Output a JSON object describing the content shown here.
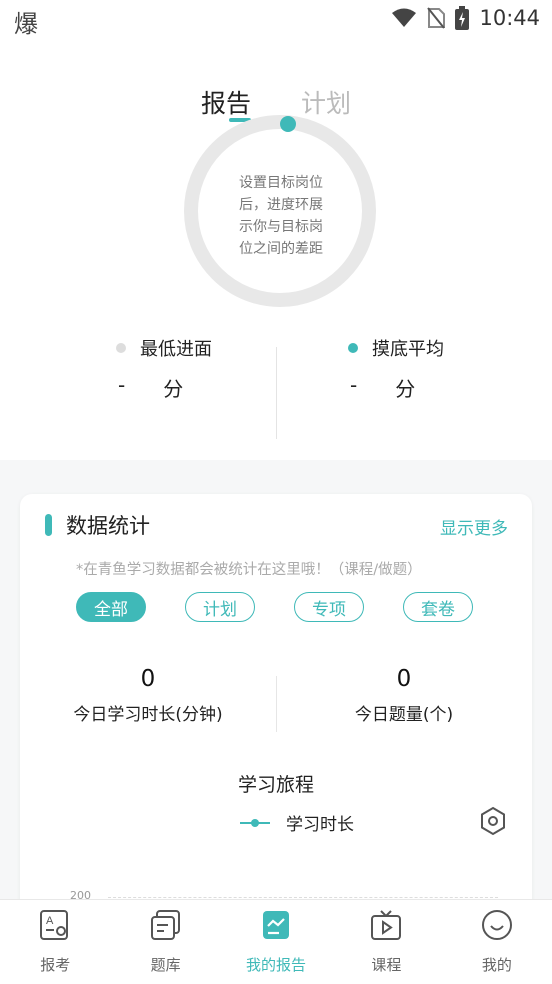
{
  "status_bar": {
    "left_glyph": "爆",
    "time": "10:44"
  },
  "tabs": [
    {
      "label": "报告",
      "active": true
    },
    {
      "label": "计划",
      "active": false
    }
  ],
  "ring": {
    "lines": [
      "设置目标岗位",
      "后，进度环展",
      "示你与目标岗",
      "位之间的差距"
    ]
  },
  "scores": {
    "min_entry": {
      "label": "最低进面",
      "value": "-",
      "unit": "分",
      "dot_color": "#dddddd"
    },
    "mock_avg": {
      "label": "摸底平均",
      "value": "-",
      "unit": "分",
      "dot_color": "#3fb9b8"
    }
  },
  "card": {
    "title": "数据统计",
    "more": "显示更多",
    "note": "*在青鱼学习数据都会被统计在这里哦！（课程/做题）",
    "filters": [
      "全部",
      "计划",
      "专项",
      "套卷"
    ],
    "active_filter": "全部",
    "stats": {
      "study_time": {
        "value": "0",
        "label": "今日学习时长(分钟)"
      },
      "question_count": {
        "value": "0",
        "label": "今日题量(个)"
      }
    },
    "journey_title": "学习旅程",
    "legend_label": "学习时长",
    "axis_tick": "200"
  },
  "bottom_nav": [
    {
      "label": "报考",
      "icon": "exam-register-icon",
      "active": false
    },
    {
      "label": "题库",
      "icon": "question-bank-icon",
      "active": false
    },
    {
      "label": "我的报告",
      "icon": "report-icon",
      "active": true
    },
    {
      "label": "课程",
      "icon": "course-tv-icon",
      "active": false
    },
    {
      "label": "我的",
      "icon": "smile-profile-icon",
      "active": false
    }
  ],
  "colors": {
    "accent": "#3fb9b8",
    "ring_track": "#e8e8e8"
  }
}
